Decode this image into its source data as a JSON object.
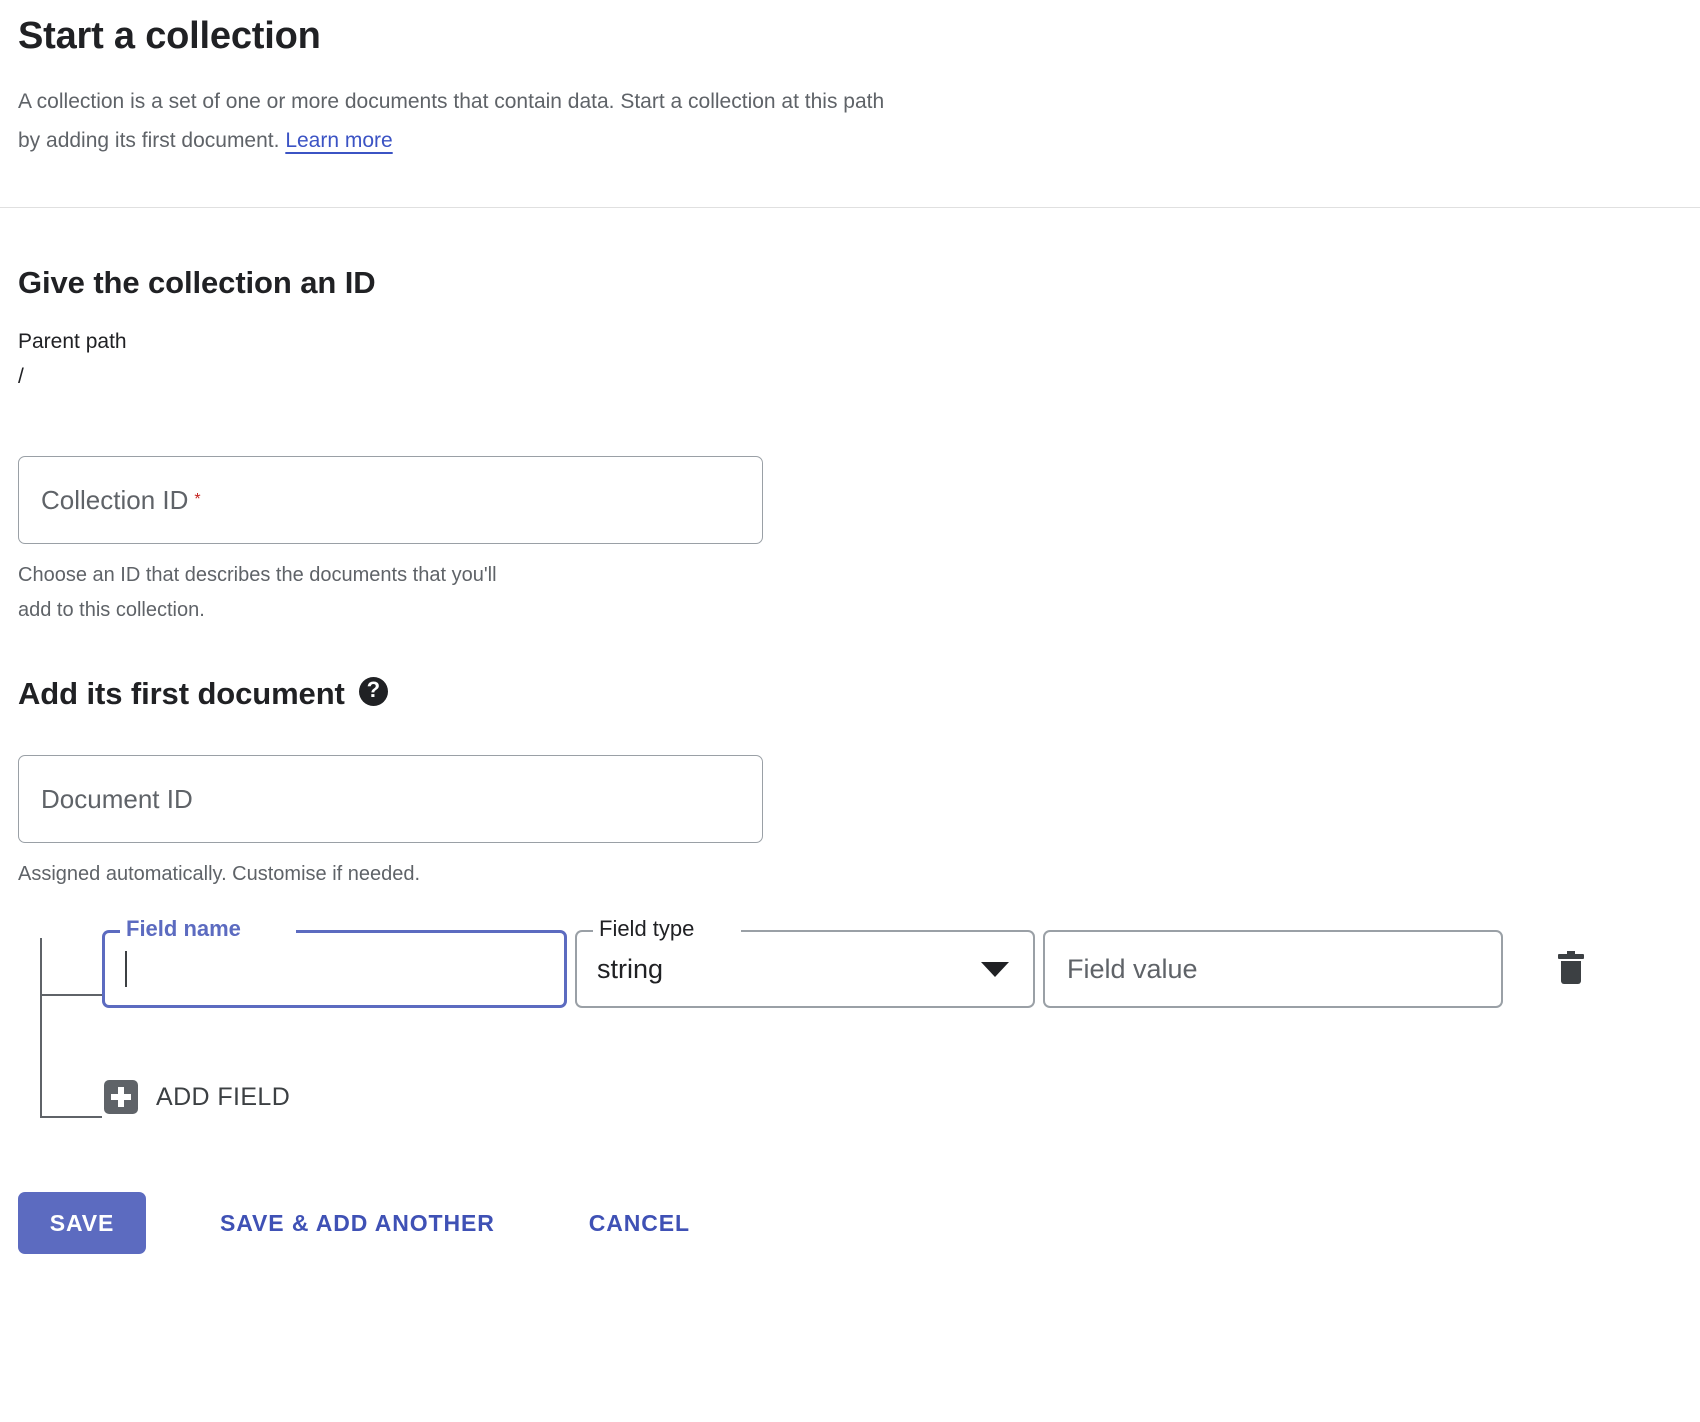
{
  "header": {
    "title": "Start a collection",
    "description_line1": "A collection is a set of one or more documents that contain data. Start a collection at this path",
    "description_line2": "by adding its first document.",
    "learn_more": "Learn more"
  },
  "collection_section": {
    "title": "Give the collection an ID",
    "parent_path_label": "Parent path",
    "parent_path_value": "/",
    "collection_id_placeholder": "Collection ID",
    "required_marker": "*",
    "hint_line1": "Choose an ID that describes the documents that you'll",
    "hint_line2": "add to this collection."
  },
  "document_section": {
    "title": "Add its first document",
    "help_icon": "help-icon",
    "help_glyph": "?",
    "document_id_placeholder": "Document ID",
    "hint": "Assigned automatically. Customise if needed."
  },
  "field_row": {
    "field_name_label": "Field name",
    "field_name_value": "",
    "field_type_label": "Field type",
    "field_type_value": "string",
    "field_type_arrow_icon": "chevron-down-icon",
    "field_value_placeholder": "Field value",
    "delete_icon": "trash-icon"
  },
  "add_field": {
    "icon": "plus-icon",
    "label": "ADD FIELD"
  },
  "actions": {
    "save": "SAVE",
    "save_add_another": "SAVE & ADD ANOTHER",
    "cancel": "CANCEL"
  },
  "colors": {
    "accent": "#5c6bc0",
    "link": "#3f51b5",
    "required": "#c5221f",
    "border": "#9aa0a6",
    "text_secondary": "#5f6368"
  }
}
